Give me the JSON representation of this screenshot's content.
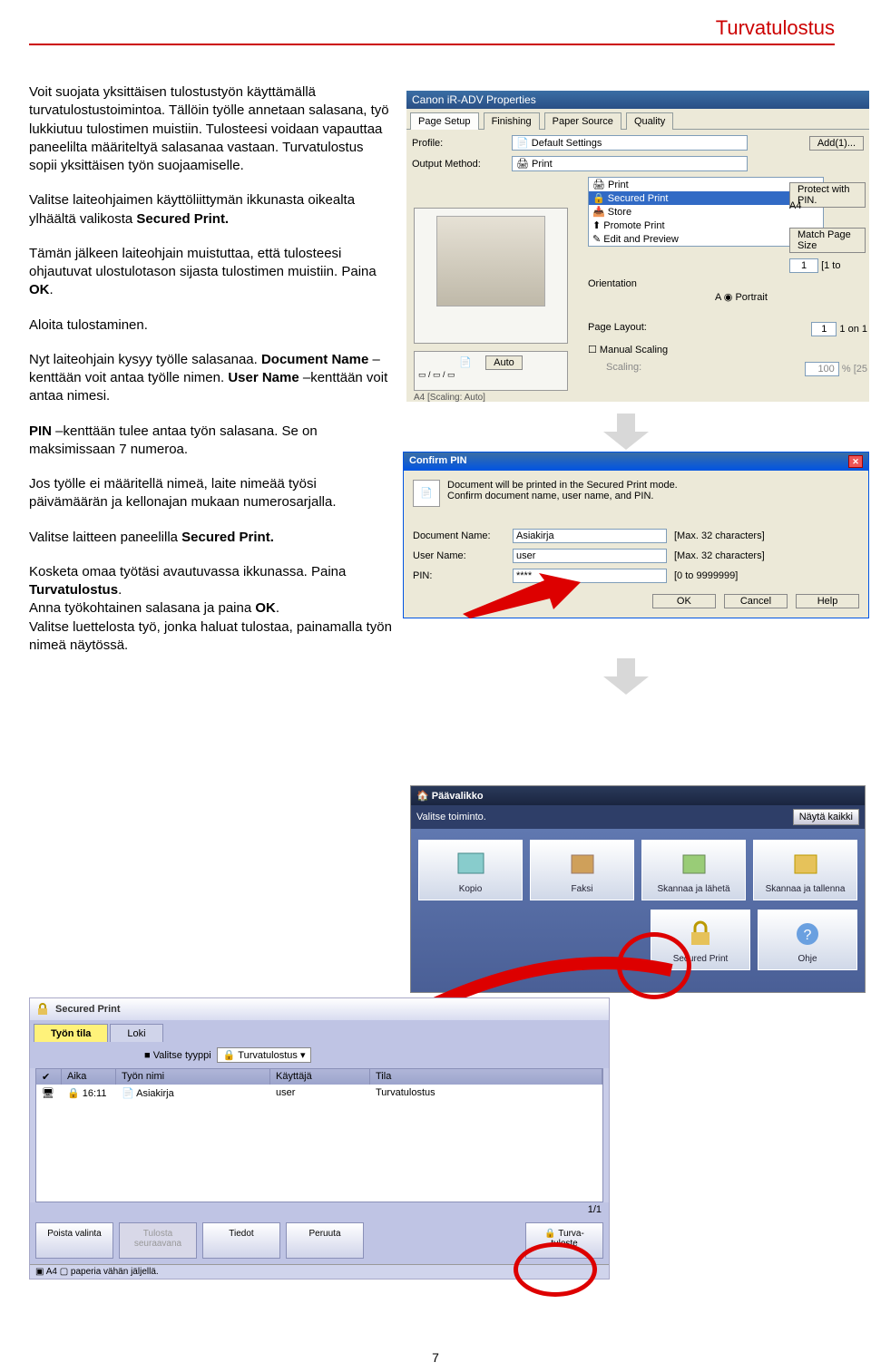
{
  "page": {
    "title": "Turvatulostus",
    "number": "7"
  },
  "intro": {
    "p1": "Voit suojata yksittäisen tulostustyön käyttämällä turvatulostustoimintoa. Tällöin työlle annetaan salasana, työ lukkiutuu tulostimen muistiin. Tulosteesi voidaan vapauttaa paneelilta määriteltyä salasanaa vastaan. Turvatulostus sopii yksittäisen työn suojaamiselle.",
    "p2a": "Valitse laiteohjaimen käyttöliittymän ikkunasta oikealta ylhäältä valikosta ",
    "p2b": "Secured Print.",
    "p3a": "Tämän jälkeen laiteohjain muistuttaa, että tulosteesi ohjautuvat ulostulotason sijasta tulostimen muistiin. Paina ",
    "p3b": "OK",
    "p3c": ".",
    "p4": "Aloita tulostaminen.",
    "p5a": "Nyt laiteohjain kysyy työlle salasanaa. ",
    "p5b": "Document Name",
    "p5c": " –kenttään voit antaa työlle nimen. ",
    "p5d": "User Name",
    "p5e": " –kenttään voit antaa nimesi.",
    "p6a": "PIN",
    "p6b": " –kenttään tulee antaa työn salasana. Se on maksimissaan 7 numeroa.",
    "p7": "Jos työlle ei määritellä nimeä, laite nimeää työsi päivämäärän ja kellonajan mukaan numero­sarjalla.",
    "p8a": "Valitse laitteen paneelilla ",
    "p8b": "Secured Print.",
    "p9a": "Kosketa omaa työtäsi avautuvassa ikkunassa. Paina ",
    "p9b": "Turvatulostus",
    "p9c": ".",
    "p9d": "Anna työkohtainen salasana ja paina ",
    "p9e": "OK",
    "p9f": ".",
    "p9g": "Valitse luettelosta työ, jonka haluat tulostaa, painamalla työn nimeä näytössä."
  },
  "props": {
    "title": "Canon iR-ADV Properties",
    "tabs": [
      "Page Setup",
      "Finishing",
      "Paper Source",
      "Quality"
    ],
    "profile_label": "Profile:",
    "profile_value": "Default Settings",
    "add": "Add(1)...",
    "output_label": "Output Method:",
    "output_value": "Print",
    "dropdown": [
      "Print",
      "Secured Print",
      "Store",
      "Promote Print",
      "Edit and Preview"
    ],
    "protect": "Protect with PIN.",
    "match": "Match Page Size",
    "a4": "A4",
    "copies": "[1 to",
    "copies_val": "1",
    "orientation": "Orientation",
    "portrait": "Portrait",
    "pagelayout": "Page Layout:",
    "oneon": "1 on 1",
    "one": "1",
    "manual": "Manual Scaling",
    "scaling": "Scaling:",
    "scaleval": "100",
    "pct": "% [25",
    "auto": "Auto",
    "a4s": "A4 [Scaling: Auto]"
  },
  "pin": {
    "title": "Confirm PIN",
    "l1": "Document will be printed in the Secured Print mode.",
    "l2": "Confirm document name, user name, and PIN.",
    "doc_label": "Document Name:",
    "doc_val": "Asiakirja",
    "doc_hint": "[Max. 32 characters]",
    "user_label": "User Name:",
    "user_val": "user",
    "user_hint": "[Max. 32 characters]",
    "pin_label": "PIN:",
    "pin_val": "****",
    "pin_hint": "[0 to 9999999]",
    "ok": "OK",
    "cancel": "Cancel",
    "help": "Help"
  },
  "mm": {
    "top": "Päävalikko",
    "sub": "Valitse toiminto.",
    "show": "Näytä kaikki",
    "cells": [
      "Kopio",
      "Faksi",
      "Skannaa ja lähetä",
      "Skannaa ja tallenna"
    ],
    "sec": "Secured Print",
    "ohje": "Ohje"
  },
  "sp": {
    "title": "Secured Print",
    "tab1": "Työn tila",
    "tab2": "Loki",
    "filter_lbl": "Valitse tyyppi",
    "filter_val": "Turvatulostus",
    "h": [
      "",
      "Aika",
      "Työn nimi",
      "Käyttäjä",
      "Tila"
    ],
    "row": {
      "time": "16:11",
      "name": "Asiakirja",
      "user": "user",
      "state": "Turvatulostus"
    },
    "pp": "1/1",
    "actions": [
      "Poista valinta",
      "Tulosta seuraavana",
      "Tiedot",
      "Peruuta",
      "Turva-tuloste"
    ],
    "status": "A4 ▢ paperia vähän jäljellä."
  }
}
